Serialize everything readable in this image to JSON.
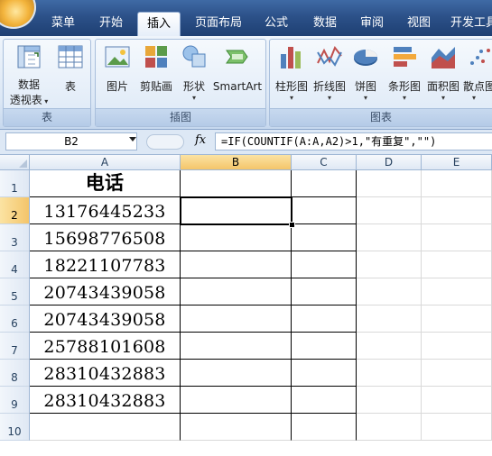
{
  "ribbon_tabs": [
    {
      "label": "菜单",
      "active": false
    },
    {
      "label": "开始",
      "active": false
    },
    {
      "label": "插入",
      "active": true
    },
    {
      "label": "页面布局",
      "active": false
    },
    {
      "label": "公式",
      "active": false
    },
    {
      "label": "数据",
      "active": false
    },
    {
      "label": "审阅",
      "active": false
    },
    {
      "label": "视图",
      "active": false
    },
    {
      "label": "开发工具",
      "active": false
    }
  ],
  "groups": {
    "table": {
      "label": "表",
      "pivot_line1": "数据",
      "pivot_line2": "透视表",
      "table_btn": "表"
    },
    "illustrations": {
      "label": "插图",
      "picture": "图片",
      "clipart": "剪贴画",
      "shapes": "形状",
      "smartart": "SmartArt"
    },
    "charts": {
      "label": "图表",
      "column": "柱形图",
      "line": "折线图",
      "pie": "饼图",
      "bar": "条形图",
      "area": "面积图",
      "scatter": "散点图"
    }
  },
  "icons": {
    "office_button": "office-logo-icon",
    "fx": "function-icon"
  },
  "formula_bar": {
    "name_box": "B2",
    "fx_label": "fx",
    "formula": "=IF(COUNTIF(A:A,A2)>1,\"有重复\",\"\")"
  },
  "sheet": {
    "columns": [
      "A",
      "B",
      "C",
      "D",
      "E"
    ],
    "selected_column": "B",
    "selected_row": "2",
    "rows": [
      {
        "num": "1",
        "a": "电话"
      },
      {
        "num": "2",
        "a": "13176445233"
      },
      {
        "num": "3",
        "a": "15698776508"
      },
      {
        "num": "4",
        "a": "18221107783"
      },
      {
        "num": "5",
        "a": "20743439058"
      },
      {
        "num": "6",
        "a": "20743439058"
      },
      {
        "num": "7",
        "a": "25788101608"
      },
      {
        "num": "8",
        "a": "28310432883"
      },
      {
        "num": "9",
        "a": "28310432883"
      },
      {
        "num": "10",
        "a": ""
      }
    ]
  },
  "colors": {
    "ribbon_dark": "#1e3f73",
    "selection_header": "#f4c56a"
  }
}
